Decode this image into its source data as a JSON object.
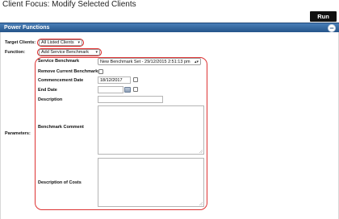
{
  "page": {
    "title": "Client Focus: Modify Selected Clients"
  },
  "toolbar": {
    "run_label": "Run"
  },
  "panel": {
    "title": "Power Functions",
    "collapse_symbol": "−"
  },
  "form": {
    "target_clients": {
      "label": "Target Clients:",
      "value": "All Listed Clients"
    },
    "function": {
      "label": "Function:",
      "value": "Add Service Benchmark"
    },
    "parameters_label": "Parameters:"
  },
  "params": {
    "service_benchmark": {
      "label": "Service Benchmark",
      "value": "New Benchmark Set - 29/12/2015 2:51:13 pm"
    },
    "remove_current": {
      "label": "Remove Current Benchmarks",
      "checked": false
    },
    "commencement_date": {
      "label": "Commencement Date",
      "value": "18/12/2017"
    },
    "end_date": {
      "label": "End Date",
      "value": ""
    },
    "description": {
      "label": "Description",
      "value": ""
    },
    "benchmark_comment": {
      "label": "Benchmark Comment",
      "value": ""
    },
    "description_of_costs": {
      "label": "Description of Costs",
      "value": ""
    }
  },
  "colors": {
    "header_top": "#4a7fb8",
    "header_bottom": "#24548a",
    "highlight": "#dd2222",
    "run_button": "#111111"
  }
}
